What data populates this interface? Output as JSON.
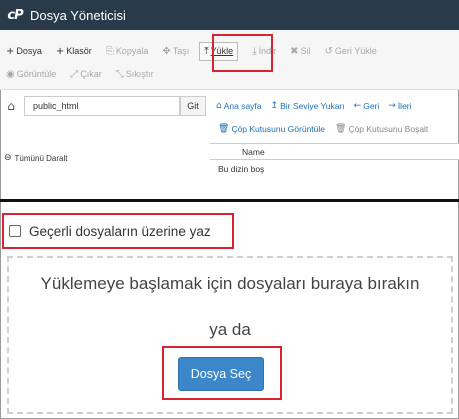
{
  "app": {
    "logo": "cP",
    "title": "Dosya Yöneticisi"
  },
  "toolbar": {
    "row1": [
      {
        "icon": "plus-icon",
        "glyph": "+",
        "label": "Dosya",
        "enabled": true
      },
      {
        "icon": "plus-icon",
        "glyph": "+",
        "label": "Klasör",
        "enabled": true
      },
      {
        "icon": "copy-icon",
        "glyph": "⎘",
        "label": "Kopyala",
        "enabled": false
      },
      {
        "icon": "move-icon",
        "glyph": "✥",
        "label": "Taşı",
        "enabled": false
      },
      {
        "icon": "upload-icon",
        "glyph": "⤒",
        "label": "Yükle",
        "enabled": true,
        "active": true
      },
      {
        "icon": "download-icon",
        "glyph": "⤓",
        "label": "İndir",
        "enabled": false
      },
      {
        "icon": "delete-icon",
        "glyph": "✖",
        "label": "Sil",
        "enabled": false
      },
      {
        "icon": "restore-icon",
        "glyph": "↺",
        "label": "Geri Yükle",
        "enabled": false
      }
    ],
    "row2": [
      {
        "icon": "eye-icon",
        "glyph": "◉",
        "label": "Görüntüle",
        "enabled": false
      },
      {
        "icon": "extract-icon",
        "glyph": "⤢",
        "label": "Çıkar",
        "enabled": false
      },
      {
        "icon": "compress-icon",
        "glyph": "⤡",
        "label": "Sıkıştır",
        "enabled": false
      }
    ]
  },
  "left": {
    "home_icon": "⌂",
    "path_value": "public_html",
    "go_label": "Git",
    "collapse_label": "Tümünü Daralt",
    "collapse_icon": "⊖"
  },
  "right": {
    "nav": [
      {
        "icon": "home-icon",
        "glyph": "⌂",
        "label": "Ana sayfa"
      },
      {
        "icon": "level-up-icon",
        "glyph": "↥",
        "label": "Bir Seviye Yukarı"
      },
      {
        "icon": "back-icon",
        "glyph": "←",
        "label": "Geri"
      },
      {
        "icon": "forward-icon",
        "glyph": "→",
        "label": "İleri"
      }
    ],
    "trash": [
      {
        "icon": "trash-icon",
        "glyph": "🗑",
        "label": "Çöp Kutusunu Görüntüle",
        "enabled": true
      },
      {
        "icon": "trash-icon",
        "glyph": "🗑",
        "label": "Çöp Kutusunu Boşalt",
        "enabled": false
      }
    ],
    "table_header": "Name",
    "empty_message": "Bu dizin boş"
  },
  "upload": {
    "overwrite_label": "Geçerli dosyaların üzerine yaz",
    "overwrite_checked": false,
    "drop_message": "Yüklemeye başlamak için dosyaları buraya bırakın",
    "or_label": "ya da",
    "select_button": "Dosya Seç"
  },
  "colors": {
    "titlebar": "#293a4a",
    "link": "#1a6fc2",
    "highlight": "#d9232e",
    "primary_button": "#3b87c9"
  }
}
